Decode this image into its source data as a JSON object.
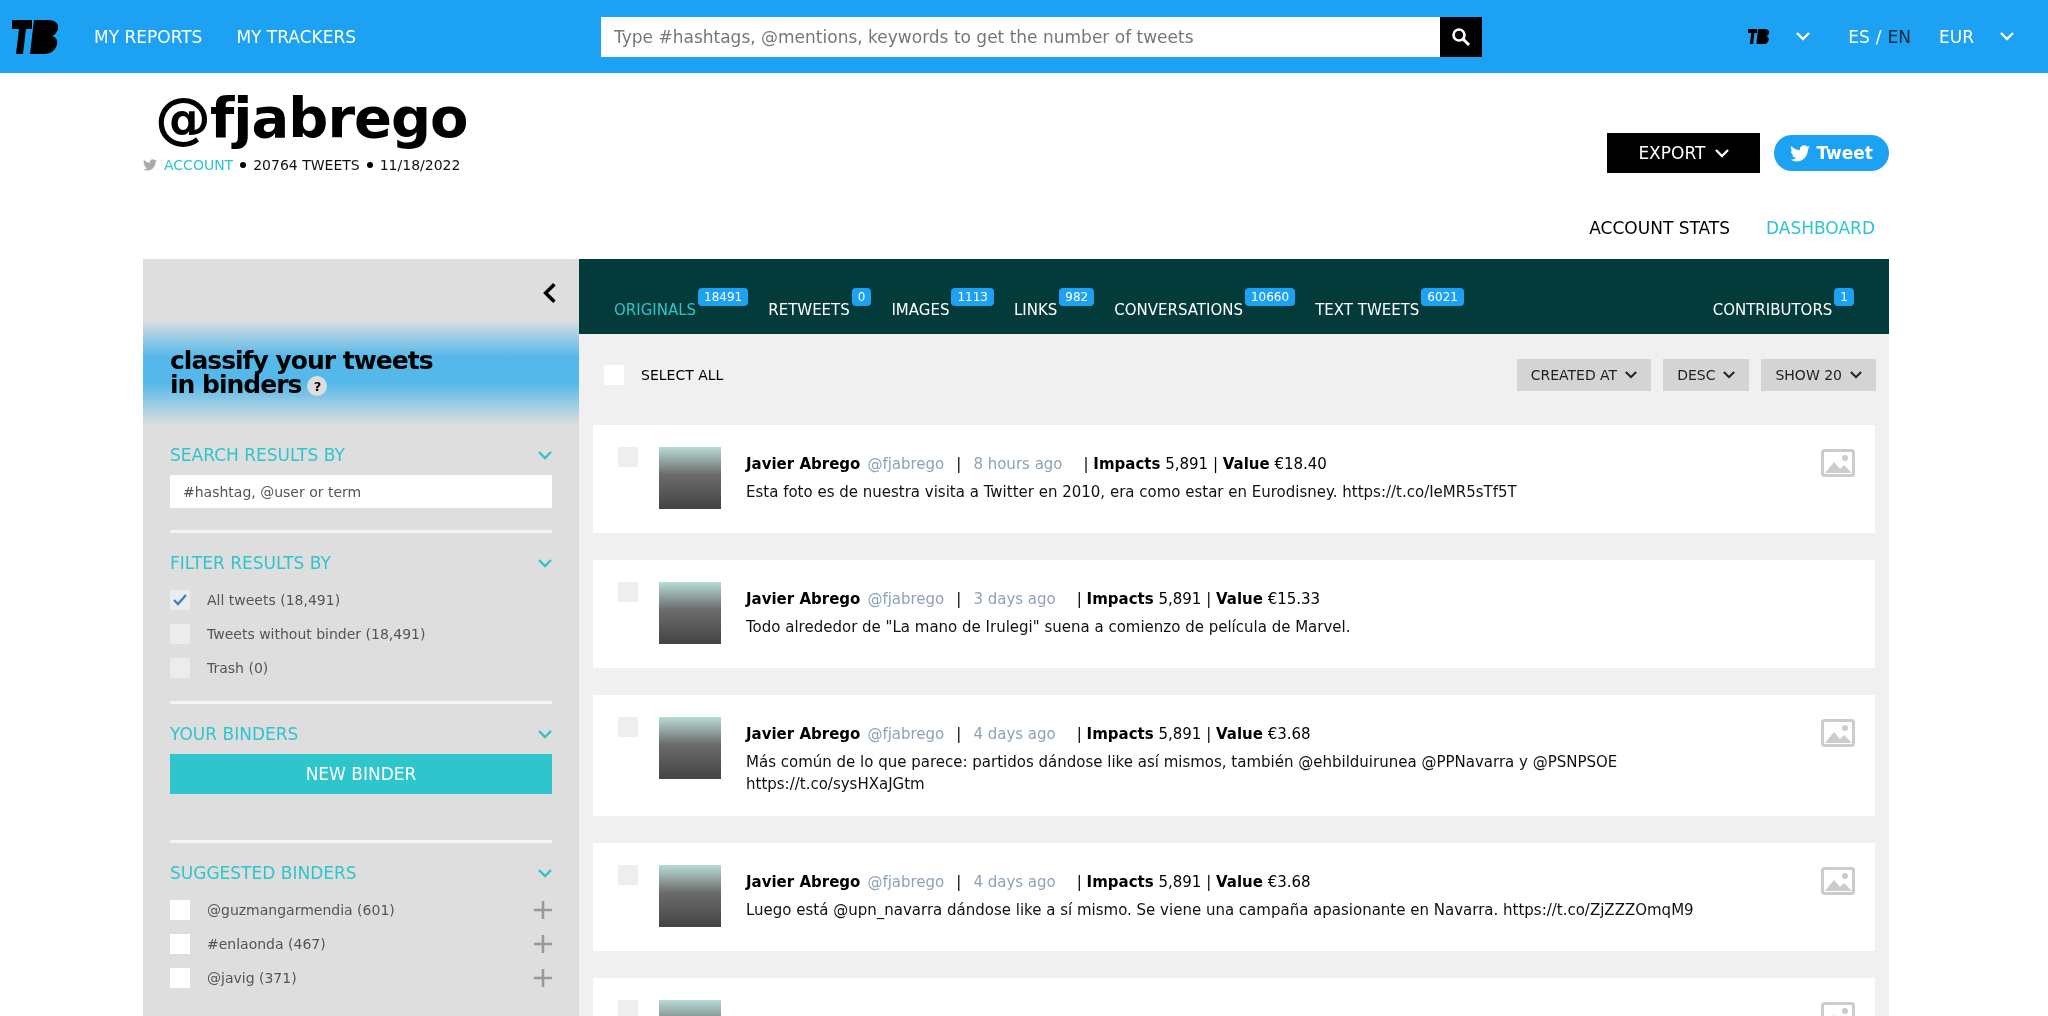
{
  "header": {
    "nav": [
      {
        "label": "MY REPORTS"
      },
      {
        "label": "MY TRACKERS"
      }
    ],
    "search": {
      "placeholder": "Type #hashtags, @mentions, keywords to get the number of tweets"
    },
    "languages": [
      {
        "label": "ES",
        "selected": false
      },
      {
        "label": "EN",
        "selected": true
      }
    ],
    "language_separator": "/",
    "currency": "EUR"
  },
  "profile": {
    "handle": "@fjabrego",
    "account_label": "ACCOUNT",
    "tweets": "20764 TWEETS",
    "date": "11/18/2022",
    "export_label": "EXPORT",
    "tweet_label": "Tweet"
  },
  "views": [
    {
      "label": "ACCOUNT STATS",
      "selected": false
    },
    {
      "label": "DASHBOARD",
      "selected": true
    }
  ],
  "sidebar": {
    "title_lines": [
      "classify your tweets",
      "in binders"
    ],
    "help": "?",
    "search": {
      "title": "SEARCH RESULTS BY",
      "placeholder": "#hashtag, @user or term"
    },
    "filter": {
      "title": "FILTER RESULTS BY",
      "options": [
        {
          "label": "All tweets (18,491)",
          "checked": true
        },
        {
          "label": "Tweets without binder (18,491)",
          "checked": false
        },
        {
          "label": "Trash (0)",
          "checked": false
        }
      ]
    },
    "binders": {
      "title": "YOUR BINDERS",
      "button": "NEW BINDER"
    },
    "suggested": {
      "title": "SUGGESTED BINDERS",
      "items": [
        {
          "label": "@guzmangarmendia (601)",
          "checked": false
        },
        {
          "label": "#enlaonda (467)",
          "checked": false
        },
        {
          "label": "@javig (371)",
          "checked": false
        }
      ]
    }
  },
  "tabs": [
    {
      "label": "ORIGINALS",
      "count": "18491",
      "selected": true
    },
    {
      "label": "RETWEETS",
      "count": "0",
      "selected": false
    },
    {
      "label": "IMAGES",
      "count": "1113",
      "selected": false
    },
    {
      "label": "LINKS",
      "count": "982",
      "selected": false
    },
    {
      "label": "CONVERSATIONS",
      "count": "10660",
      "selected": false
    },
    {
      "label": "TEXT TWEETS",
      "count": "6021",
      "selected": false
    },
    {
      "label": "CONTRIBUTORS",
      "count": "1",
      "selected": false
    }
  ],
  "toolbar": {
    "select_all": {
      "label": "SELECT ALL",
      "checked": false
    },
    "sorts": [
      {
        "label": "CREATED AT"
      },
      {
        "label": "DESC"
      },
      {
        "label": "SHOW 20"
      }
    ]
  },
  "tweets": [
    {
      "name": "Javier Abrego",
      "handle": "@fjabrego",
      "separator": "|",
      "time": "8 hours ago",
      "stats": "| **Impacts** 5,891 | **Value** €18.40",
      "text": "Esta foto es de nuestra visita a Twitter en 2010, era como estar en Eurodisney. https://t.co/IeMR5sTf5T",
      "checked": false,
      "has_image": true
    },
    {
      "name": "Javier Abrego",
      "handle": "@fjabrego",
      "separator": "|",
      "time": "3 days ago",
      "stats": "| **Impacts** 5,891 | **Value** €15.33",
      "text": "Todo alrededor de \"La mano de Irulegi\" suena a comienzo de película de Marvel.",
      "checked": false,
      "has_image": false
    },
    {
      "name": "Javier Abrego",
      "handle": "@fjabrego",
      "separator": "|",
      "time": "4 days ago",
      "stats": "| **Impacts** 5,891 | **Value** €3.68",
      "text": "Más común de lo que parece: partidos dándose like así mismos, también @ehbilduirunea @PPNavarra y @PSNPSOE https://t.co/sysHXaJGtm",
      "checked": false,
      "has_image": true
    },
    {
      "name": "Javier Abrego",
      "handle": "@fjabrego",
      "separator": "|",
      "time": "4 days ago",
      "stats": "| **Impacts** 5,891 | **Value** €3.68",
      "text": "Luego está @upn_navarra dándose like a sí mismo. Se viene una campaña apasionante en Navarra. https://t.co/ZjZZZOmqM9",
      "checked": false,
      "has_image": true
    }
  ],
  "partial_tweet": {
    "checked": false,
    "has_image": true
  }
}
